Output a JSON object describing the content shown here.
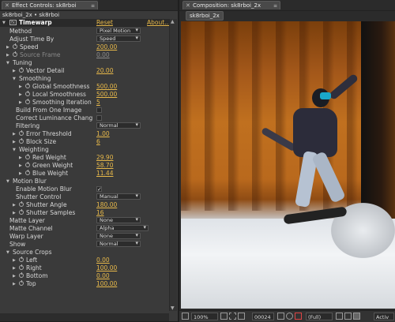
{
  "left_panel": {
    "tab_title": "Effect Controls: sk8rboi",
    "breadcrumb": "sk8rboi_2x • sk8rboi",
    "effect": {
      "name": "Timewarp",
      "reset": "Reset",
      "about": "About..."
    },
    "rows": [
      {
        "label": "Method",
        "dropdown": "Pixel Motion"
      },
      {
        "label": "Adjust Time By",
        "dropdown": "Speed"
      },
      {
        "label": "Speed",
        "value": "200.00",
        "stopwatch": true,
        "twirl": "closed"
      },
      {
        "label": "Source Frame",
        "value": "0.00",
        "stopwatch": true,
        "twirl": "closed",
        "dim": true
      },
      {
        "label": "Tuning",
        "section": true
      },
      {
        "label": "Vector Detail",
        "value": "20.00",
        "stopwatch": true,
        "twirl": "closed",
        "indent": 1
      },
      {
        "label": "Smoothing",
        "section": true,
        "indent": 1
      },
      {
        "label": "Global Smoothness",
        "value": "500.00",
        "stopwatch": true,
        "twirl": "closed",
        "indent": 2
      },
      {
        "label": "Local Smoothness",
        "value": "500.00",
        "stopwatch": true,
        "twirl": "closed",
        "indent": 2
      },
      {
        "label": "Smoothing Iteration",
        "value": "5",
        "stopwatch": true,
        "twirl": "closed",
        "indent": 2
      },
      {
        "label": "Build From One Image",
        "checkbox": false,
        "indent": 1
      },
      {
        "label": "Correct Luminance Chang",
        "checkbox": false,
        "indent": 1
      },
      {
        "label": "Filtering",
        "dropdown": "Normal",
        "indent": 1
      },
      {
        "label": "Error Threshold",
        "value": "1.00",
        "stopwatch": true,
        "twirl": "closed",
        "indent": 1
      },
      {
        "label": "Block Size",
        "value": "6",
        "stopwatch": true,
        "twirl": "closed",
        "indent": 1
      },
      {
        "label": "Weighting",
        "section": true,
        "indent": 1
      },
      {
        "label": "Red Weight",
        "value": "29.90",
        "stopwatch": true,
        "twirl": "closed",
        "indent": 2
      },
      {
        "label": "Green Weight",
        "value": "58.70",
        "stopwatch": true,
        "twirl": "closed",
        "indent": 2
      },
      {
        "label": "Blue Weight",
        "value": "11.44",
        "stopwatch": true,
        "twirl": "closed",
        "indent": 2
      },
      {
        "label": "Motion Blur",
        "section": true
      },
      {
        "label": "Enable Motion Blur",
        "checkbox": true,
        "indent": 1
      },
      {
        "label": "Shutter Control",
        "dropdown": "Manual",
        "indent": 1
      },
      {
        "label": "Shutter Angle",
        "value": "180.00",
        "stopwatch": true,
        "twirl": "closed",
        "indent": 1
      },
      {
        "label": "Shutter Samples",
        "value": "16",
        "stopwatch": true,
        "twirl": "closed",
        "indent": 1
      },
      {
        "label": "Matte Layer",
        "dropdown": "None"
      },
      {
        "label": "Matte Channel",
        "dropdown": "Alpha",
        "wide": true
      },
      {
        "label": "Warp Layer",
        "dropdown": "None"
      },
      {
        "label": "Show",
        "dropdown": "Normal"
      },
      {
        "label": "Source Crops",
        "section": true
      },
      {
        "label": "Left",
        "value": "0.00",
        "stopwatch": true,
        "twirl": "closed",
        "indent": 1
      },
      {
        "label": "Right",
        "value": "100.00",
        "stopwatch": true,
        "twirl": "closed",
        "indent": 1
      },
      {
        "label": "Bottom",
        "value": "0.00",
        "stopwatch": true,
        "twirl": "closed",
        "indent": 1
      },
      {
        "label": "Top",
        "value": "100.00",
        "stopwatch": true,
        "twirl": "closed",
        "indent": 1
      }
    ]
  },
  "right_panel": {
    "tab_title": "Composition: sk8rboi_2x",
    "breadcrumb": "sk8rboi_2x",
    "bottom": {
      "zoom": "100%",
      "timecode": "00024",
      "resolution": "(Full)",
      "view": "Activ"
    }
  }
}
